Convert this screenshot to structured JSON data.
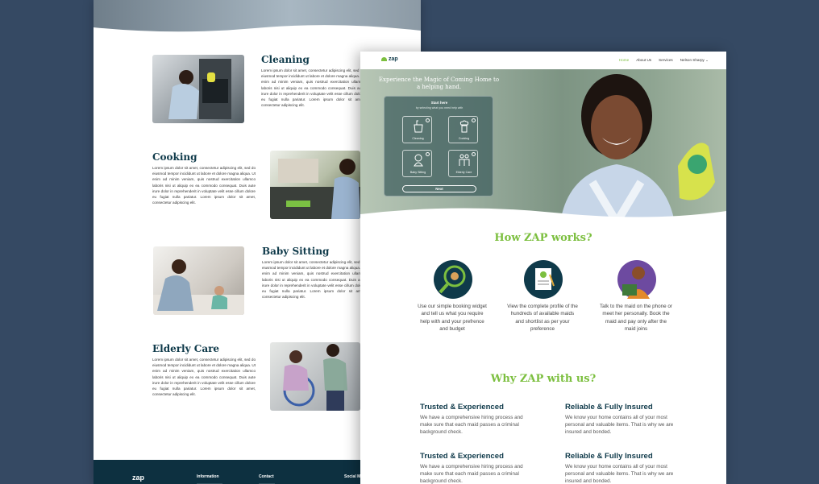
{
  "back": {
    "services": [
      {
        "title": "Cleaning",
        "text": "Lorem ipsum dolor sit amet, consectetur adipiscing elit, sed do eiusmod tempor incididunt ut labore et dolore magna aliqua. Ut enim ad minim veniam, quis nostrud exercitation ullamco laboris nisi ut aliquip ex ea commodo consequat. Duis aute irure dolor in reprehenderit in voluptate velit esse cillum dolore eu fugiat nulla pariatur. Lorem ipsum dolor sit amet, consectetur adipiscing elit."
      },
      {
        "title": "Cooking",
        "text": "Lorem ipsum dolor sit amet, consectetur adipiscing elit, sed do eiusmod tempor incididunt ut labore et dolore magna aliqua. Ut enim ad minim veniam, quis nostrud exercitation ullamco laboris nisi ut aliquip ex ea commodo consequat. Duis aute irure dolor in reprehenderit in voluptate velit esse cillum dolore eu fugiat nulla pariatur. Lorem ipsum dolor sit amet, consectetur adipiscing elit."
      },
      {
        "title": "Baby Sitting",
        "text": "Lorem ipsum dolor sit amet, consectetur adipiscing elit, sed do eiusmod tempor incididunt ut labore et dolore magna aliqua. Ut enim ad minim veniam, quis nostrud exercitation ullamco laboris nisi ut aliquip ex ea commodo consequat. Duis aute irure dolor in reprehenderit in voluptate velit esse cillum dolore eu fugiat nulla pariatur. Lorem ipsum dolor sit amet, consectetur adipiscing elit."
      },
      {
        "title": "Elderly Care",
        "text": "Lorem ipsum dolor sit amet, consectetur adipiscing elit, sed do eiusmod tempor incididunt ut labore et dolore magna aliqua. Ut enim ad minim veniam, quis nostrud exercitation ullamco laboris nisi ut aliquip ex ea commodo consequat. Duis aute irure dolor in reprehenderit in voluptate velit esse cillum dolore eu fugiat nulla pariatur. Lorem ipsum dolor sit amet, consectetur adipiscing elit."
      }
    ],
    "footer": {
      "logo": "zap",
      "information": "Information",
      "contact": "Contact",
      "social": "Social M"
    }
  },
  "front": {
    "logo": "zap",
    "nav": [
      "Home",
      "About Us",
      "Services",
      "Nelson Sharpy"
    ],
    "hero_title": "Experience the Magic of Coming Home to a helping hand.",
    "widget": {
      "heading": "Start here",
      "subheading": "by selecting what you need help with",
      "options": [
        "Cleaning",
        "Cooking",
        "Baby Sitting",
        "Elderly Care"
      ],
      "next_label": "Next"
    },
    "how_title": "How ZAP works?",
    "steps": [
      "Use our simple booking widget and tell us what you require help with and your prefrence and budget",
      "View the complete profile of the hundreds of available maids and shortlist as per your preference",
      "Talk to the maid on the phone or meet her personally. Book the maid and pay only after the maid joins"
    ],
    "why_title": "Why ZAP with us?",
    "reasons": [
      {
        "title": "Trusted & Experienced",
        "text": "We have a comprehensive hiring process and make sure that each maid passes a criminal background check."
      },
      {
        "title": "Reliable & Fully Insured",
        "text": "We know your home contains all of your most personal and valuable items. That is why we are insured and bonded."
      },
      {
        "title": "Trusted & Experienced",
        "text": "We have a comprehensive hiring process and make sure that each maid passes a criminal background check."
      },
      {
        "title": "Reliable & Fully Insured",
        "text": "We know your home contains all of your most personal and valuable items. That is why we are insured and bonded."
      }
    ]
  },
  "colors": {
    "background": "#354963",
    "brand_green": "#7cbf3f",
    "brand_dark": "#0f3a4a"
  }
}
